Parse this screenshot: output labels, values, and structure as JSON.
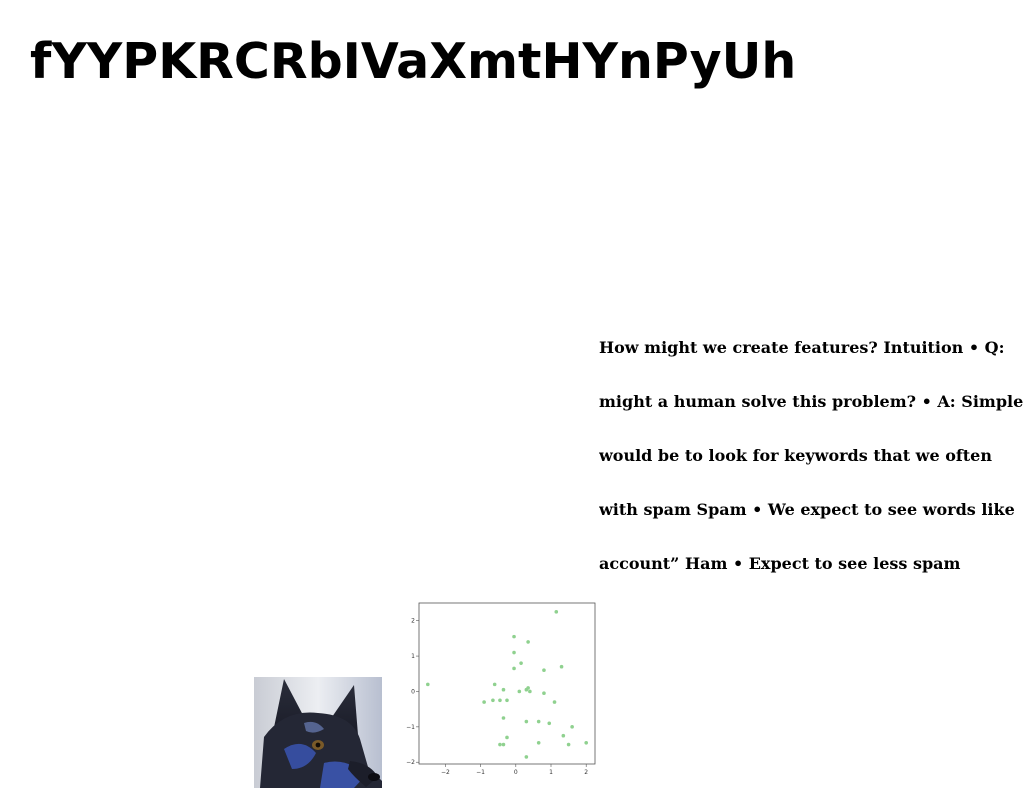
{
  "title": "fYYPKRCRbIVaXmtHYnPyUh",
  "body_lines": [
    "How might we create features? Intuition • Q:",
    "might a human solve this problem? • A: Simple",
    "would be to look for keywords that we often",
    "with spam Spam • We expect to see words like",
    "account” Ham • Expect to see less spam"
  ],
  "photo": {
    "subject": "dog",
    "colors": {
      "dark": "#1e2233",
      "blue": "#3a55b0",
      "light": "#d9dbe0"
    }
  },
  "chart_data": {
    "type": "scatter",
    "title": "",
    "xlabel": "",
    "ylabel": "",
    "xlim": [
      -2.75,
      2.25
    ],
    "ylim": [
      -2.05,
      2.5
    ],
    "xticks": [
      -2,
      -1,
      0,
      1,
      2
    ],
    "yticks": [
      -2,
      -1,
      0,
      1,
      2
    ],
    "xtick_labels": [
      "−2",
      "−1",
      "0",
      "1",
      "2"
    ],
    "ytick_labels": [
      "−2",
      "−1",
      "0",
      "1",
      "2"
    ],
    "grid": false,
    "point_color": "#8fd18f",
    "points": [
      [
        -2.5,
        0.2
      ],
      [
        -0.9,
        -0.3
      ],
      [
        -0.6,
        0.2
      ],
      [
        -0.65,
        -0.25
      ],
      [
        -0.45,
        -0.25
      ],
      [
        -0.35,
        0.05
      ],
      [
        -0.25,
        -0.25
      ],
      [
        -0.35,
        -0.75
      ],
      [
        -0.45,
        -1.5
      ],
      [
        -0.35,
        -1.5
      ],
      [
        -0.25,
        -1.3
      ],
      [
        -0.05,
        1.55
      ],
      [
        -0.05,
        1.1
      ],
      [
        -0.05,
        0.65
      ],
      [
        0.15,
        0.8
      ],
      [
        0.35,
        1.4
      ],
      [
        0.1,
        0.0
      ],
      [
        0.3,
        0.05
      ],
      [
        0.35,
        0.1
      ],
      [
        0.4,
        0.0
      ],
      [
        0.3,
        -0.85
      ],
      [
        0.3,
        -1.85
      ],
      [
        0.65,
        -0.85
      ],
      [
        0.65,
        -1.45
      ],
      [
        0.8,
        0.6
      ],
      [
        0.8,
        -0.05
      ],
      [
        0.95,
        -0.9
      ],
      [
        1.1,
        -0.3
      ],
      [
        1.15,
        2.25
      ],
      [
        1.3,
        0.7
      ],
      [
        1.35,
        -1.25
      ],
      [
        1.5,
        -1.5
      ],
      [
        1.6,
        -1.0
      ],
      [
        2.0,
        -1.45
      ]
    ]
  }
}
